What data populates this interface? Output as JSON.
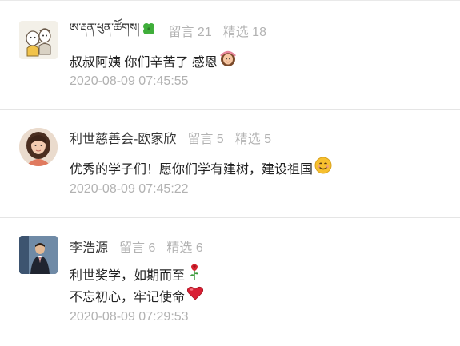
{
  "comments": [
    {
      "name": "ཨ་རྡན་ཕུན་ཚོགས།",
      "name_suffix_icon": "four-leaf-clover-icon",
      "messages_label": "留言 21",
      "selected_label": "精选 18",
      "lines": [
        "叔叔阿姨 你们辛苦了 感恩"
      ],
      "line_emoji": [
        "person-gesturing-ok-icon"
      ],
      "timestamp": "2020-08-09 07:45:55",
      "avatar": "cartoon-avatar"
    },
    {
      "name": "利世慈善会-欧家欣",
      "messages_label": "留言 5",
      "selected_label": "精选 5",
      "lines": [
        "优秀的学子们！愿你们学有建树，建设祖国"
      ],
      "line_emoji": [
        "smiling-face-icon"
      ],
      "timestamp": "2020-08-09 07:45:22",
      "avatar": "photo-avatar-woman"
    },
    {
      "name": "李浩源",
      "messages_label": "留言 6",
      "selected_label": "精选 6",
      "lines": [
        "利世奖学，如期而至",
        "不忘初心，牢记使命"
      ],
      "line_emoji": [
        "rose-icon",
        "red-heart-icon"
      ],
      "timestamp": "2020-08-09 07:29:53",
      "avatar": "photo-avatar-man"
    }
  ],
  "colors": {
    "name": "#333333",
    "meta": "#b2b2b2",
    "text": "#222222",
    "divider": "#e5e5e5"
  }
}
